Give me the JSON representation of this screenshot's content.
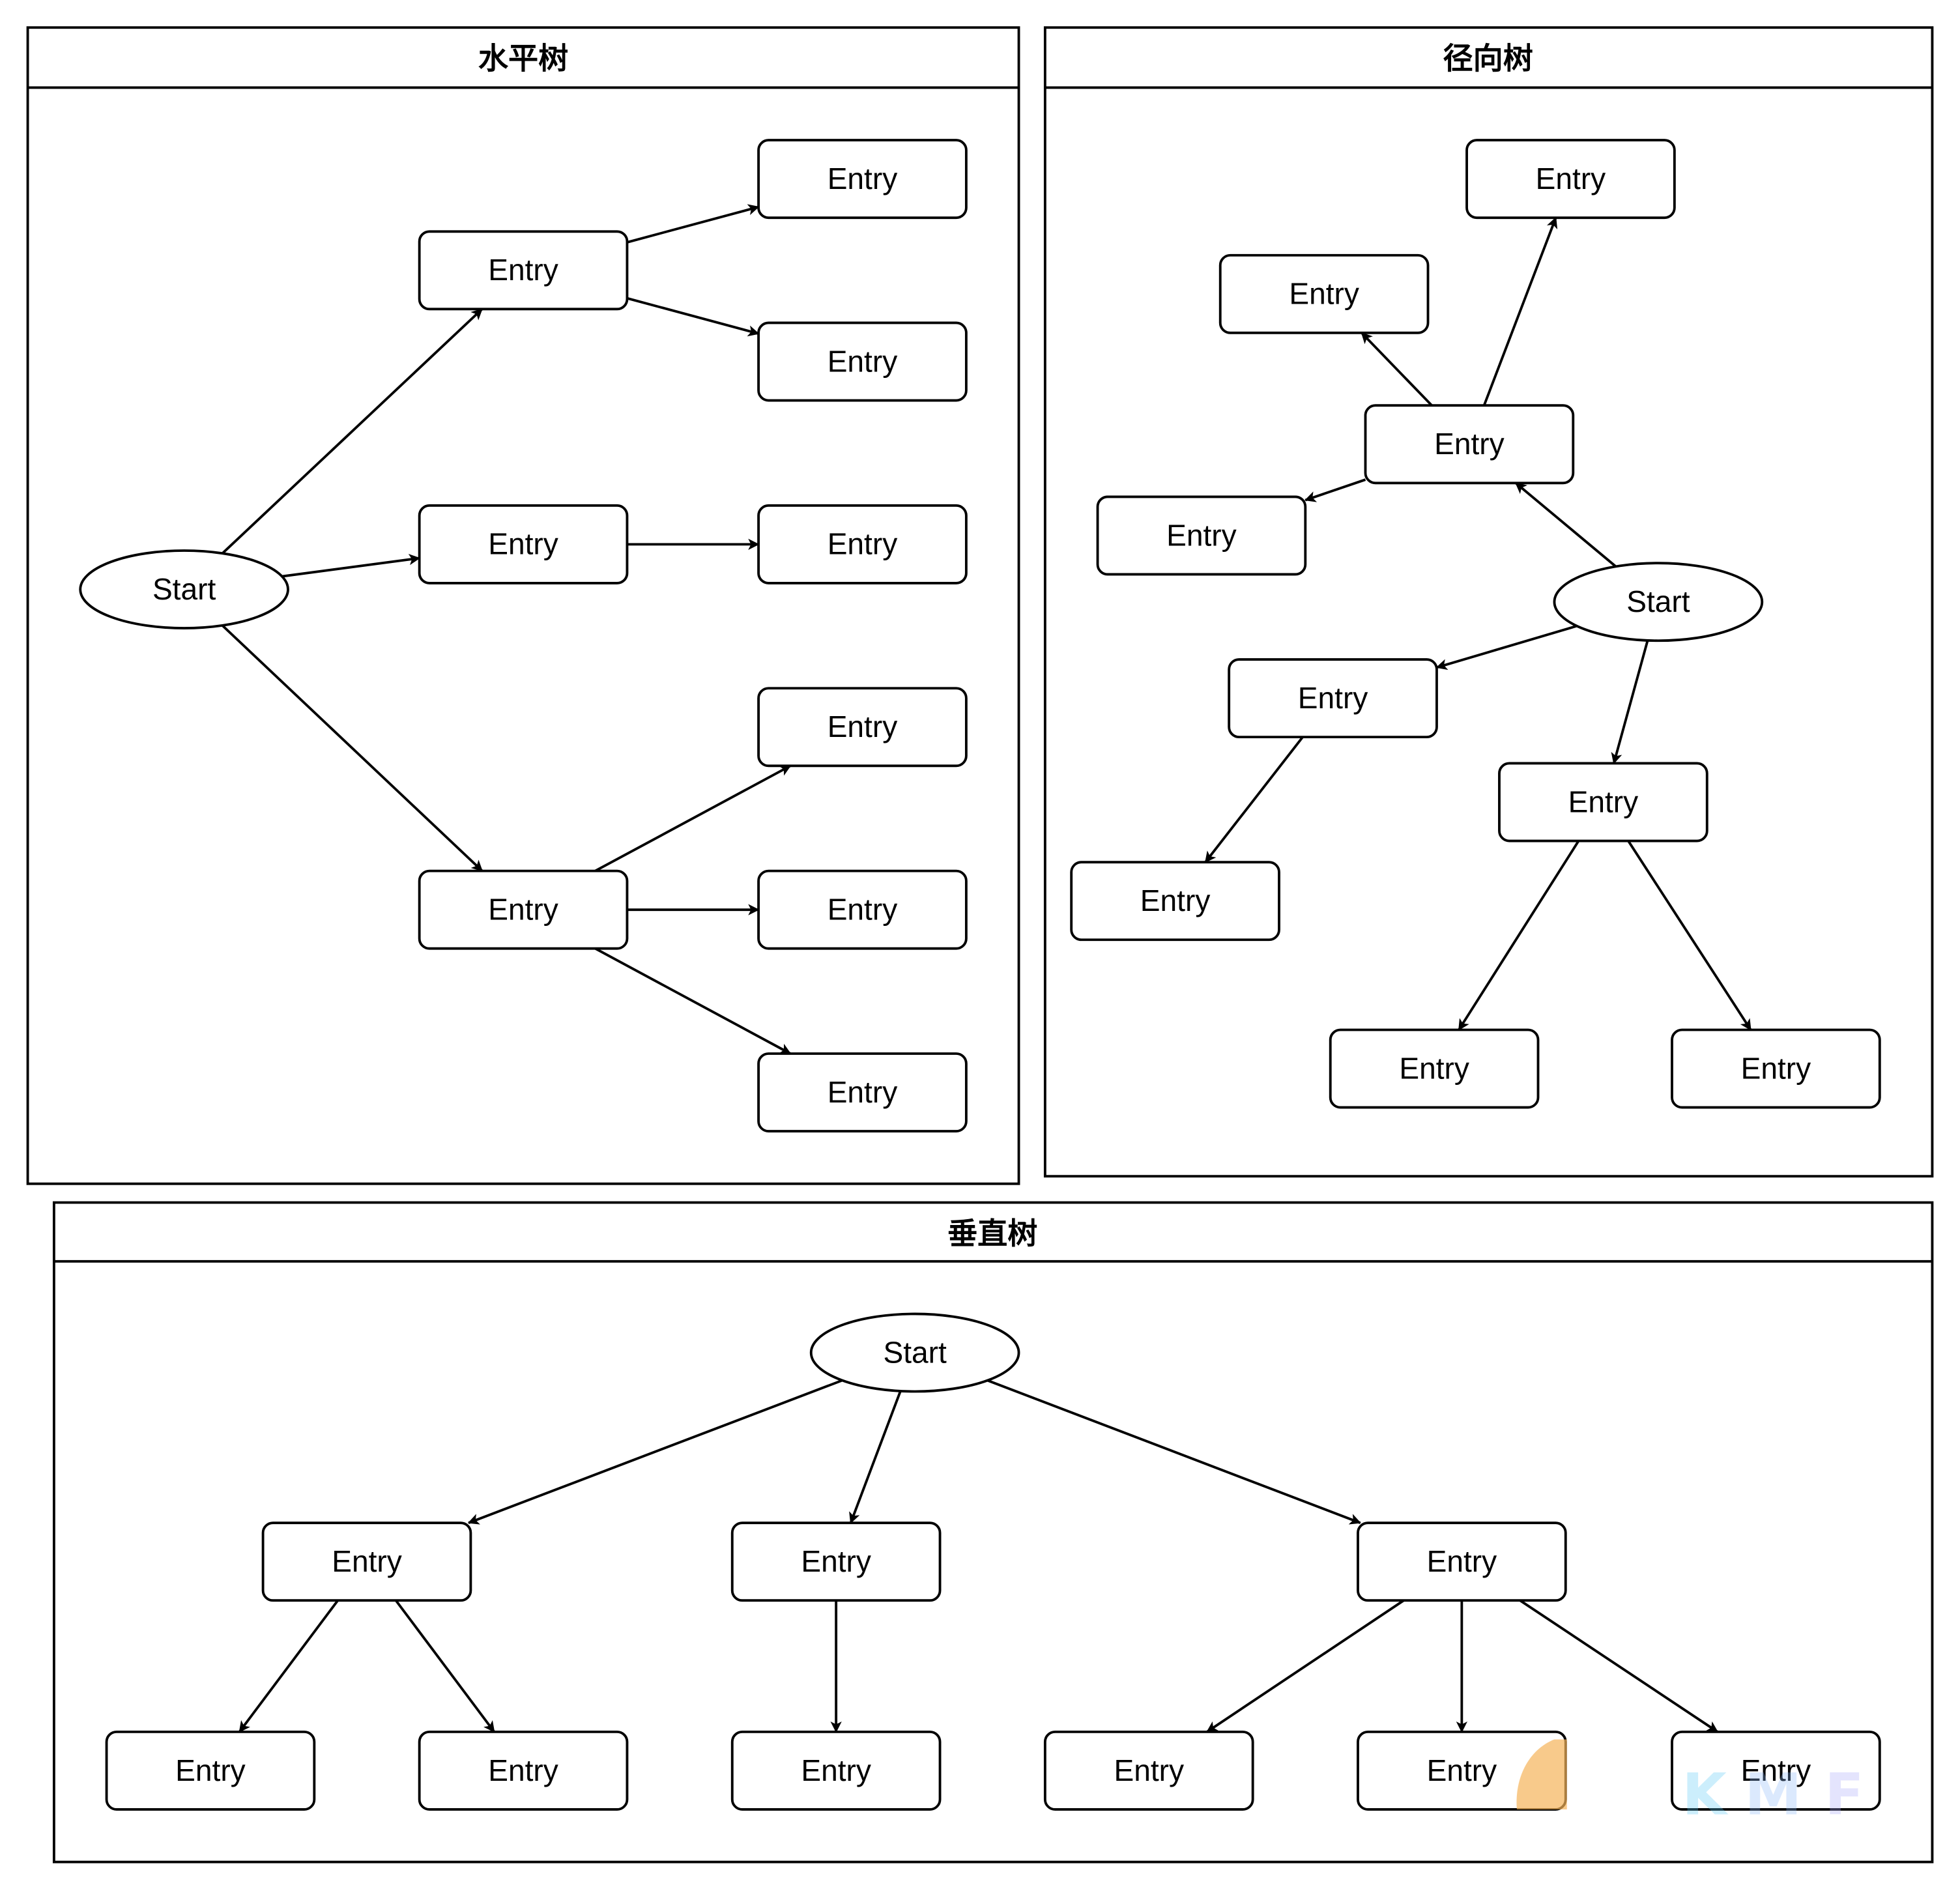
{
  "panels": [
    {
      "id": "horizontal",
      "title": "水平树"
    },
    {
      "id": "radial",
      "title": "径向树"
    },
    {
      "id": "vertical",
      "title": "垂直树"
    }
  ],
  "labels": {
    "start": "Start",
    "entry": "Entry"
  },
  "trees": {
    "horizontal": {
      "nodes": [
        {
          "id": "s",
          "type": "start"
        },
        {
          "id": "a",
          "type": "entry"
        },
        {
          "id": "b",
          "type": "entry"
        },
        {
          "id": "c",
          "type": "entry"
        },
        {
          "id": "a1",
          "type": "entry"
        },
        {
          "id": "a2",
          "type": "entry"
        },
        {
          "id": "b1",
          "type": "entry"
        },
        {
          "id": "c1",
          "type": "entry"
        },
        {
          "id": "c2",
          "type": "entry"
        },
        {
          "id": "c3",
          "type": "entry"
        }
      ],
      "edges": [
        [
          "s",
          "a"
        ],
        [
          "s",
          "b"
        ],
        [
          "s",
          "c"
        ],
        [
          "a",
          "a1"
        ],
        [
          "a",
          "a2"
        ],
        [
          "b",
          "b1"
        ],
        [
          "c",
          "c1"
        ],
        [
          "c",
          "c2"
        ],
        [
          "c",
          "c3"
        ]
      ]
    },
    "radial": {
      "nodes": [
        {
          "id": "s",
          "type": "start"
        },
        {
          "id": "u",
          "type": "entry"
        },
        {
          "id": "u1",
          "type": "entry"
        },
        {
          "id": "u2",
          "type": "entry"
        },
        {
          "id": "u3",
          "type": "entry"
        },
        {
          "id": "l",
          "type": "entry"
        },
        {
          "id": "l1",
          "type": "entry"
        },
        {
          "id": "d",
          "type": "entry"
        },
        {
          "id": "d1",
          "type": "entry"
        },
        {
          "id": "d2",
          "type": "entry"
        }
      ],
      "edges": [
        [
          "s",
          "u"
        ],
        [
          "u",
          "u1"
        ],
        [
          "u",
          "u2"
        ],
        [
          "u",
          "u3"
        ],
        [
          "s",
          "l"
        ],
        [
          "l",
          "l1"
        ],
        [
          "s",
          "d"
        ],
        [
          "d",
          "d1"
        ],
        [
          "d",
          "d2"
        ]
      ]
    },
    "vertical": {
      "nodes": [
        {
          "id": "s",
          "type": "start"
        },
        {
          "id": "a",
          "type": "entry"
        },
        {
          "id": "b",
          "type": "entry"
        },
        {
          "id": "c",
          "type": "entry"
        },
        {
          "id": "a1",
          "type": "entry"
        },
        {
          "id": "a2",
          "type": "entry"
        },
        {
          "id": "b1",
          "type": "entry"
        },
        {
          "id": "c1",
          "type": "entry"
        },
        {
          "id": "c2",
          "type": "entry"
        },
        {
          "id": "c3",
          "type": "entry"
        }
      ],
      "edges": [
        [
          "s",
          "a"
        ],
        [
          "s",
          "b"
        ],
        [
          "s",
          "c"
        ],
        [
          "a",
          "a1"
        ],
        [
          "a",
          "a2"
        ],
        [
          "b",
          "b1"
        ],
        [
          "c",
          "c1"
        ],
        [
          "c",
          "c2"
        ],
        [
          "c",
          "c3"
        ]
      ]
    }
  },
  "watermark": {
    "text": "KMF",
    "colors": [
      "#5ecbf5",
      "#8fb8f8",
      "#a8a8f8"
    ],
    "badge_color": "#f5b35a"
  }
}
